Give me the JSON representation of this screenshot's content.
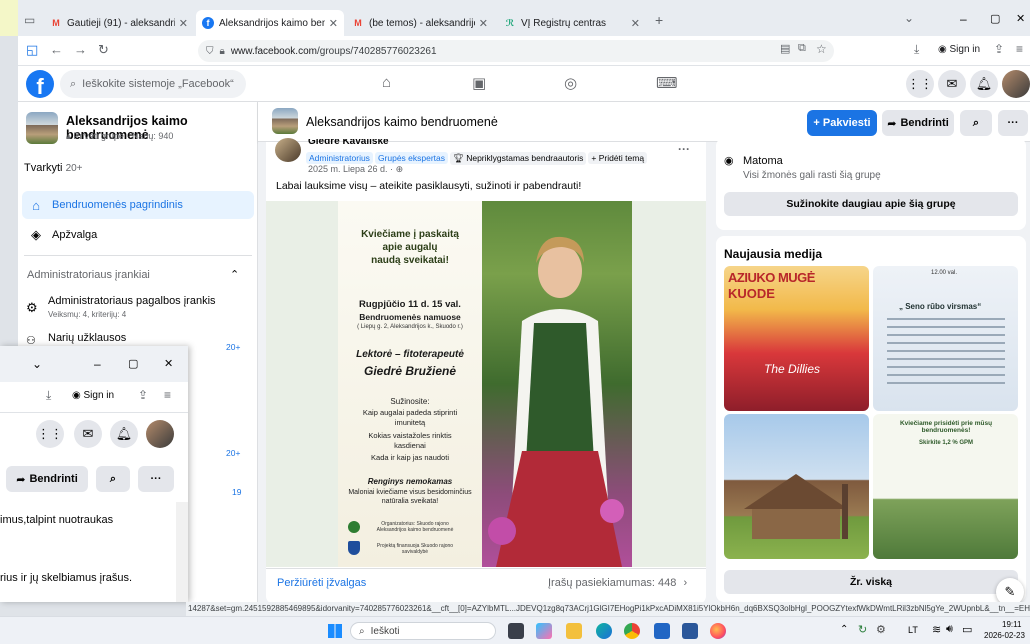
{
  "tabs": [
    {
      "label": "Gautieji (91) - aleksandrijosbendr",
      "icon": "gmail-icon"
    },
    {
      "label": "Aleksandrijos kaimo bendruomenė",
      "icon": "facebook-icon",
      "active": true
    },
    {
      "label": "(be temos) - aleksandrijosbendr",
      "icon": "gmail-icon"
    },
    {
      "label": "VĮ Registrų centras",
      "icon": "registrai-icon"
    }
  ],
  "new_tab": "+",
  "window_controls": {
    "list": "⌄",
    "min": "–",
    "max": "▢",
    "close": "✕"
  },
  "nav": {
    "url_host": "www.facebook.com",
    "url_path": "/groups/740285776023261",
    "signin": "Sign in"
  },
  "fb": {
    "logo": "f",
    "search_placeholder": "Ieškokite sistemoje „Facebook“"
  },
  "group": {
    "name": "Aleksandrijos kaimo bendruomenė",
    "privacy": "Privati grupė · Narių: 940",
    "invite": "+ Pakviesti",
    "share": "Bendrinti",
    "more": "···"
  },
  "left": {
    "manage": "Tvarkyti",
    "manage_count": "20+",
    "home": "Bendruomenės pagrindinis",
    "overview": "Apžvalga",
    "admin_tools": "Administratoriaus įrankiai",
    "admin_help": "Administratoriaus pagalbos įrankis",
    "admin_help_sub": "Veiksmų: 4, kriterijų: 4",
    "member_requests": "Narių užklausos",
    "count_a": "20+",
    "count_b": "20+",
    "count_c": "19"
  },
  "post": {
    "author": "Giedrė Kavaliskė",
    "badges": [
      "Administratorius",
      "Grupės ekspertas",
      "Nepriklygstamas bendraautoris",
      "+ Pridėti temą"
    ],
    "date": "2025 m. Liepa 26 d. ·",
    "text": "Labai lauksime visų – ateikite pasiklausyti, sužinoti ir pabendrauti!",
    "more": "···",
    "view_insights": "Peržiūrėti įžvalgas",
    "engagement": "Įrašų pasiekiamumas: 448"
  },
  "poster": {
    "l1": "Kviečiame į paskaitą",
    "l2": "apie augalų",
    "l3": "naudą sveikatai!",
    "date": "Rugpjūčio 11 d. 15 val.",
    "place": "Bendruomenės namuose",
    "addr": "( Liepų g. 2, Aleksandrijos k., Skuodo r.)",
    "lect": "Lektorė – fitoterapeutė",
    "lect_name": "Giedrė Bružienė",
    "learn": "Sužinosite:",
    "b1": "Kaip augalai padeda stiprinti imunitetą",
    "b2": "Kokias vaistažoles rinktis kasdienai",
    "b3": "Kada ir kaip jas naudoti",
    "free": "Renginys nemokamas",
    "invite": "Maloniai kviečiame visus besidominčius natūralia sveikata!",
    "org": "Organizatorius: Skuodo rajono Aleksandrijos kaimo bendruomenė",
    "fin": "Projektą finansuoja Skuodo rajono savivaldybė"
  },
  "right": {
    "visible_title": "Matoma",
    "visible_sub": "Visi žmonės gali rasti šią grupę",
    "learn_more": "Sužinokite daugiau apie šią grupę",
    "media_title": "Naujausia medija",
    "see_all": "Žr. viską",
    "media1_t1": "AZIUKO MUGĖ",
    "media1_t2": "KUODE",
    "media1_t3": "The Dillies",
    "media2_t1": "12.00 val.",
    "media2_t2": "„ Seno rūbo virsmas“",
    "media4_t1": "Kviečiame prisidėti prie mūsų bendruomenės!",
    "media4_t2": "Skirkite 1,2 % GPM"
  },
  "overlay": {
    "signin": "Sign in",
    "share": "Bendrinti",
    "more": "···",
    "line1": "imus,talpint nuotraukas",
    "line2": "rius ir jų skelbiamus įrašus."
  },
  "status_url": "14287&set=gm.2451592885469895&idorvanity=740285776023261&__cft__[0]=AZYlbMTL...JDEVQ1zg8q73ACrj1GlGI7EHogPi1kPxcADiMX81i5YlOkbH6n_dq6BXSQ3olbHgl_POOGZYtexfWkDWmtLRil3zbNl5gYe_2WUpnbL&__tn__=EH-R",
  "taskbar": {
    "search": "Ieškoti",
    "lang": "LT",
    "time": "19:11",
    "date": "2026-02-23"
  }
}
